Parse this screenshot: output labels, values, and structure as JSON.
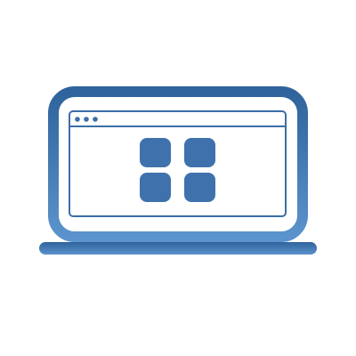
{
  "icon": {
    "name": "laptop-app-grid-icon",
    "colors": {
      "top": "#2f639c",
      "bottom": "#5b93cc",
      "tile": "#3f72ad",
      "window_border": "#3b6ea8",
      "background": "#ffffff"
    },
    "window_dots": 3,
    "app_tiles": 4
  }
}
